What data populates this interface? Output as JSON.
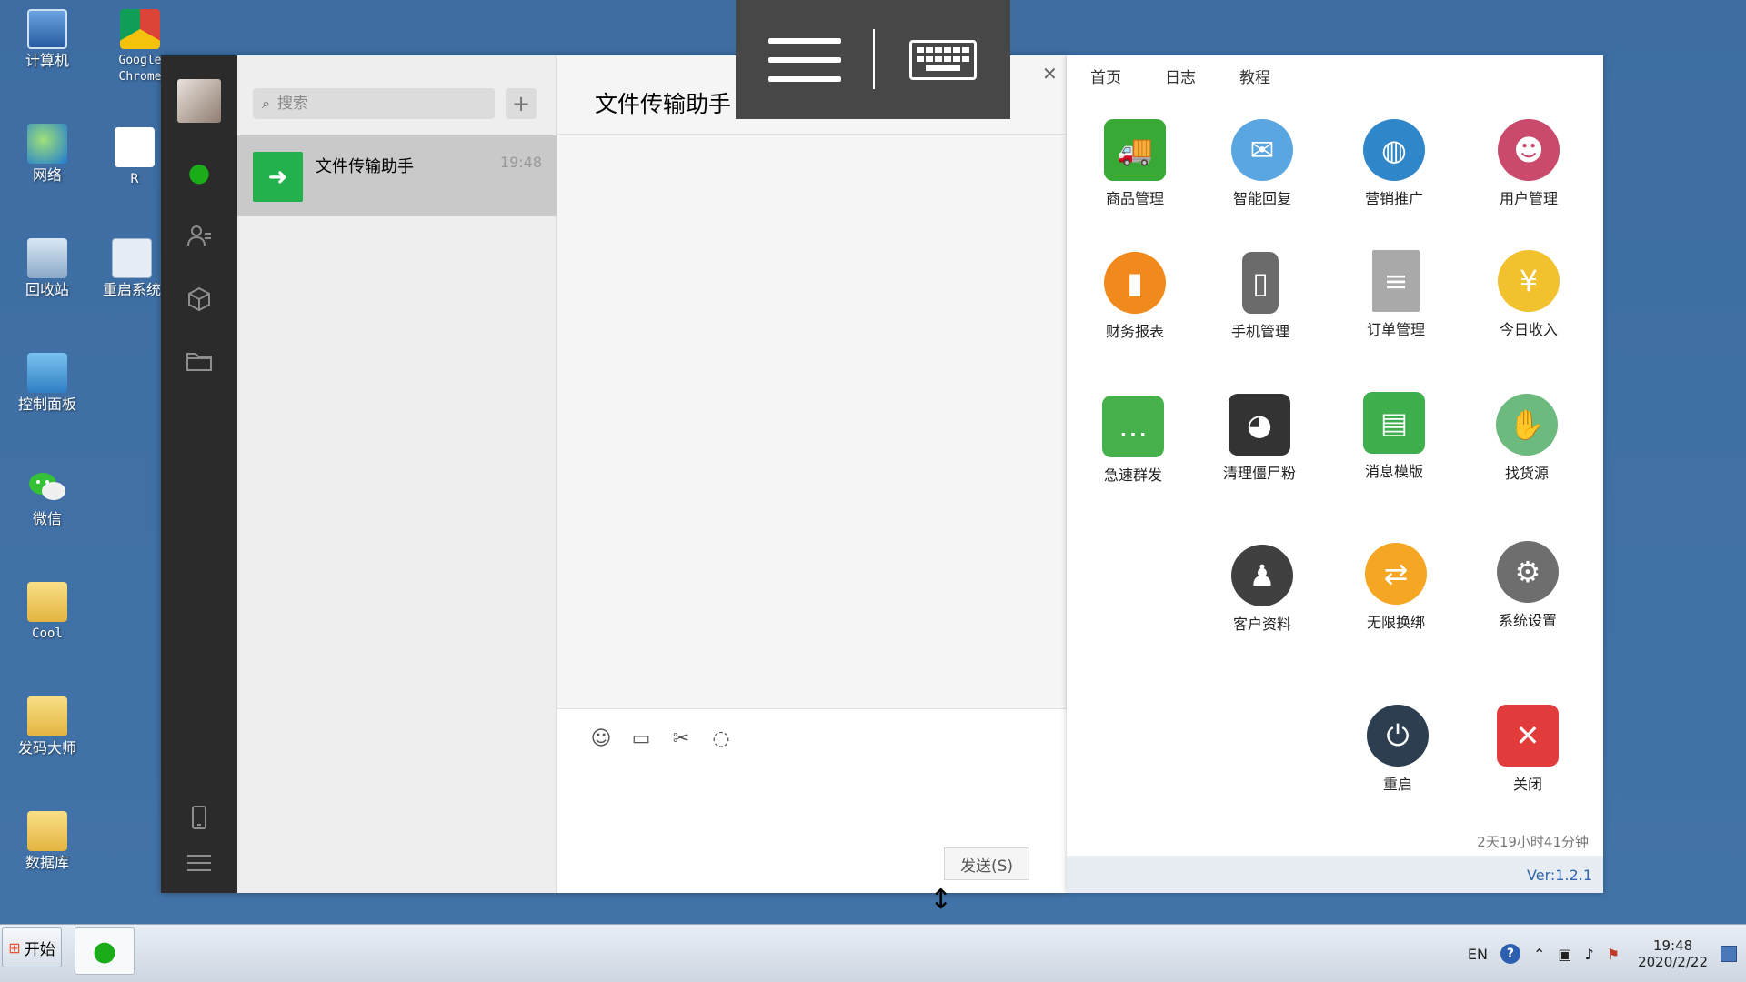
{
  "desktop": {
    "icons": [
      {
        "label": "计算机",
        "icon": "computer-icon"
      },
      {
        "label": "Google Chrome",
        "icon": "chrome-icon"
      },
      {
        "label": "网络",
        "icon": "network-icon"
      },
      {
        "label": "R",
        "icon": "file-icon"
      },
      {
        "label": "回收站",
        "icon": "recycle-bin-icon"
      },
      {
        "label": "重启系统",
        "icon": "restart-system-icon"
      },
      {
        "label": "控制面板",
        "icon": "control-panel-icon"
      },
      {
        "label": "微信",
        "icon": "wechat-icon"
      },
      {
        "label": "Cool",
        "icon": "folder-icon"
      },
      {
        "label": "发码大师",
        "icon": "folder-icon"
      },
      {
        "label": "数据库",
        "icon": "folder-icon"
      }
    ]
  },
  "wechat": {
    "search_placeholder": "搜索",
    "add_label": "+",
    "chat_list": [
      {
        "name": "文件传输助手",
        "time": "19:48"
      }
    ],
    "chat_title": "文件传输助手",
    "send_label": "发送(S)"
  },
  "panel": {
    "tabs": [
      "首页",
      "日志",
      "教程"
    ],
    "tiles": [
      {
        "label": "商品管理",
        "icon": "truck-icon",
        "color": "#39a935"
      },
      {
        "label": "智能回复",
        "icon": "envelope-icon",
        "color": "#5aa6e0"
      },
      {
        "label": "营销推广",
        "icon": "globe-icon",
        "color": "#2f86c9"
      },
      {
        "label": "用户管理",
        "icon": "users-icon",
        "color": "#c94a6a"
      },
      {
        "label": "财务报表",
        "icon": "chart-icon",
        "color": "#f08a1c"
      },
      {
        "label": "手机管理",
        "icon": "phone-icon",
        "color": "#6b6b6b"
      },
      {
        "label": "订单管理",
        "icon": "document-icon",
        "color": "#a9a9a9"
      },
      {
        "label": "今日收入",
        "icon": "coins-icon",
        "color": "#f2c12e"
      },
      {
        "label": "急速群发",
        "icon": "chat-bubbles-icon",
        "color": "#46b14a"
      },
      {
        "label": "清理僵尸粉",
        "icon": "wechat-icon",
        "color": "#333333"
      },
      {
        "label": "消息模版",
        "icon": "message-template-icon",
        "color": "#3fae4d"
      },
      {
        "label": "找货源",
        "icon": "handshake-icon",
        "color": "#6cba7d"
      },
      {
        "label": "客户资料",
        "icon": "customer-icon",
        "color": "#404040"
      },
      {
        "label": "无限换绑",
        "icon": "swap-arrows-icon",
        "color": "#f5a623"
      },
      {
        "label": "系统设置",
        "icon": "settings-icon",
        "color": "#6e6e6e"
      },
      {
        "label": "重启",
        "icon": "power-icon",
        "color": "#2c3e50"
      },
      {
        "label": "关闭",
        "icon": "close-icon",
        "color": "#e23b3b"
      }
    ],
    "uptime": "2天19小时41分钟",
    "version": "Ver:1.2.1"
  },
  "taskbar": {
    "start_label": "开始",
    "lang": "EN",
    "time": "19:48",
    "date": "2020/2/22"
  }
}
